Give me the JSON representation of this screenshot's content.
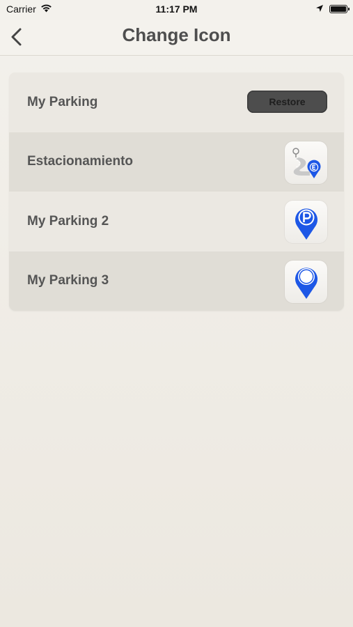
{
  "status_bar": {
    "carrier": "Carrier",
    "time": "11:17 PM"
  },
  "nav": {
    "title": "Change Icon",
    "back_icon": "chevron-left-icon"
  },
  "list": {
    "items": [
      {
        "label": "My Parking",
        "action_label": "Restore"
      },
      {
        "label": "Estacionamiento",
        "icon": "road-pin-e-icon"
      },
      {
        "label": "My Parking 2",
        "icon": "pin-p-icon"
      },
      {
        "label": "My Parking 3",
        "icon": "pin-icon"
      }
    ]
  },
  "colors": {
    "accent_blue": "#1d57e6",
    "restore_button_bg": "#4d4d4d",
    "background": "#f0ede7"
  }
}
